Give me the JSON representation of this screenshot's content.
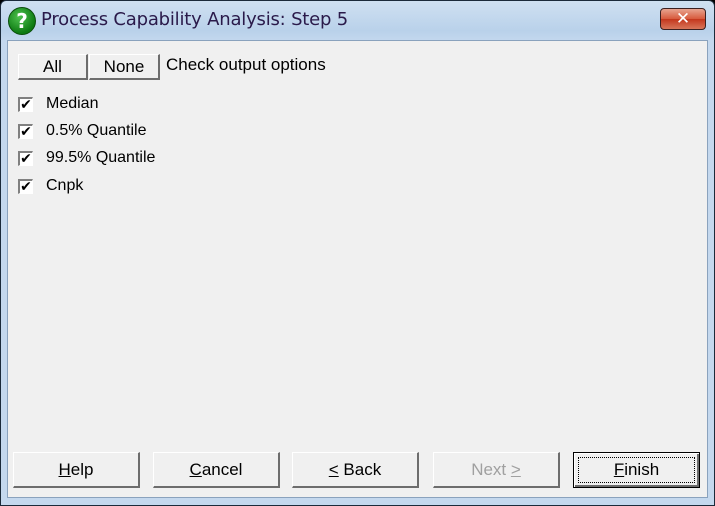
{
  "window": {
    "title": "Process Capability Analysis: Step 5",
    "icon": "help-question-icon",
    "close_glyph": "✕"
  },
  "toolbar": {
    "all_label": "All",
    "none_label": "None",
    "instruction": "Check output options"
  },
  "options": [
    {
      "label": "Median",
      "checked": true
    },
    {
      "label": "0.5% Quantile",
      "checked": true
    },
    {
      "label": "99.5% Quantile",
      "checked": true
    },
    {
      "label": "Cnpk",
      "checked": true
    }
  ],
  "footer": {
    "help": {
      "mnemonic": "H",
      "rest": "elp"
    },
    "cancel": {
      "mnemonic": "C",
      "rest": "ancel"
    },
    "back": {
      "mnemonic": "<",
      "rest": " Back"
    },
    "next": {
      "label": "Next ",
      "mnemonic": ">",
      "disabled": true
    },
    "finish": {
      "mnemonic": "F",
      "rest": "inish",
      "default": true
    }
  },
  "check_glyph": "✔"
}
